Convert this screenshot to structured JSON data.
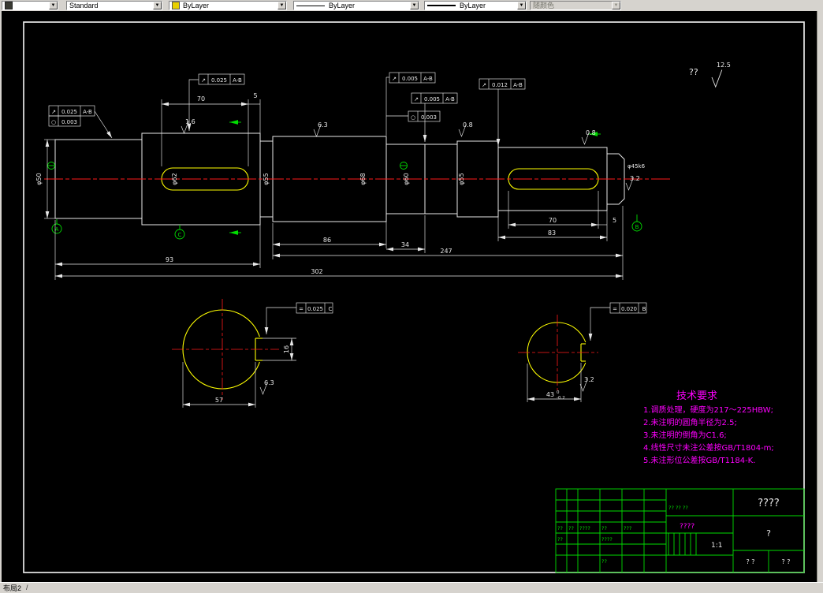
{
  "toolbar": {
    "style_value": "Standard",
    "color_value": "ByLayer",
    "linetype_value": "ByLayer",
    "lineweight_value": "ByLayer",
    "plotstyle_value": "随颜色"
  },
  "statusbar": {
    "layout_tab": "布局2",
    "tab_slash": "/"
  },
  "drawing": {
    "corner_note": "??",
    "corner_roughness": "12.5",
    "tech_req": {
      "title": "技术要求",
      "line1": "1.调质处理，硬度为217～225HBW;",
      "line2": "2.未注明的圆角半径为2.5;",
      "line3": "3.未注明的倒角为C1.6;",
      "line4": "4.线性尺寸未注公差按GB/T1804-m;",
      "line5": "5.未注形位公差按GB/T1184-K."
    },
    "dims": {
      "kw_left_len": "70",
      "kw_left_gap": "5",
      "len_86": "86",
      "len_34": "34",
      "len_247": "247",
      "len_93": "93",
      "len_83": "83",
      "len_302": "302",
      "kw_right_len": "70",
      "kw_right_gap": "5",
      "dia_1": "φ50",
      "dia_2": "φ62",
      "dia_3": "φ55",
      "dia_4": "φ68",
      "dia_5": "φ60",
      "dia_6": "φ55",
      "dia_end": "φ45k6",
      "cs_left_flat": "57",
      "cs_left_kw": "16",
      "cs_right_flat": "43",
      "cs_right_tol_upper": "0",
      "cs_right_tol_lower": "-0.2"
    },
    "fcf": {
      "f1_sym": "↗",
      "f1_val": "0.025",
      "f1_ref": "A-B",
      "f2_sym": "○",
      "f2_val": "0.003",
      "f3_sym": "↗",
      "f3_val": "0.025",
      "f3_ref": "A-B",
      "f4_sym": "↗",
      "f4_val": "0.005",
      "f4_ref": "A-B",
      "f5_sym": "↗",
      "f5_val": "0.005",
      "f5_ref": "A-B",
      "f6_sym": "○",
      "f6_val": "0.003",
      "f7_sym": "↗",
      "f7_val": "0.012",
      "f7_ref": "A-B",
      "f8_sym": "=",
      "f8_val": "0.025",
      "f8_ref": "C",
      "f9_sym": "=",
      "f9_val": "0.020",
      "f9_ref": "B"
    },
    "roughness": {
      "r1": "1.6",
      "r2": "6.3",
      "r3": "0.8",
      "r4": "0.8",
      "r5": "3.2",
      "r6": "6.3",
      "r7": "3.2"
    },
    "datums": {
      "a": "A",
      "b": "B",
      "c": "C"
    }
  },
  "title_block": {
    "header_cells": {
      "c1": "??",
      "c2": "??",
      "c3": "????",
      "c4": "??",
      "c5": "???"
    },
    "row2_left": "??",
    "row2_mid": "????",
    "bottom_left": "??",
    "mid_header": "?? ?? ??",
    "stamp": "????",
    "scale": "1:1",
    "title": "????",
    "material": "?",
    "footer_left": "? ?",
    "footer_right": "? ?"
  }
}
